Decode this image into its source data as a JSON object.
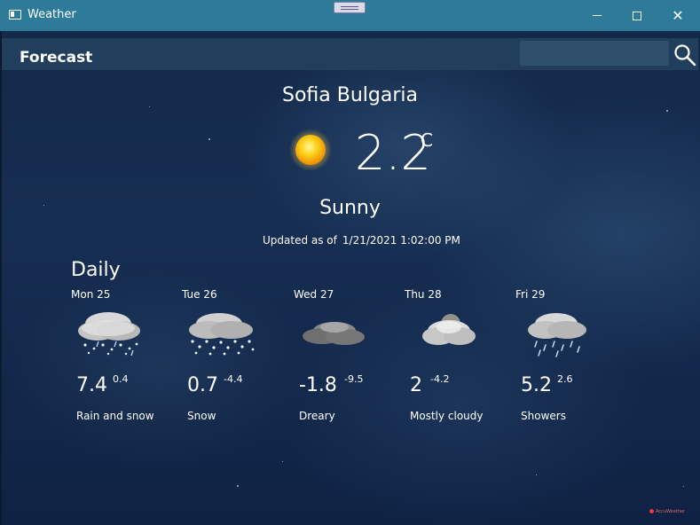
{
  "window": {
    "title": "Weather",
    "buttons": {
      "minimize": "minimize",
      "maximize": "maximize",
      "close": "close"
    }
  },
  "header": {
    "tab_label": "Forecast",
    "search": {
      "value": "",
      "placeholder": ""
    }
  },
  "current": {
    "city": "Sofia",
    "country": "Bulgaria",
    "temperature": "2.2",
    "unit": "C",
    "condition": "Sunny",
    "icon": "sun-icon",
    "updated_prefix": "Updated as of",
    "updated_time": "1/21/2021 1:02:00 PM"
  },
  "daily": {
    "title": "Daily",
    "days": [
      {
        "name": "Mon 25",
        "high": "7.4",
        "low": "0.4",
        "description": "Rain and snow",
        "icon": "rain-snow-icon"
      },
      {
        "name": "Tue 26",
        "high": "0.7",
        "low": "-4.4",
        "description": "Snow",
        "icon": "snow-icon"
      },
      {
        "name": "Wed 27",
        "high": "-1.8",
        "low": "-9.5",
        "description": "Dreary",
        "icon": "dreary-cloud-icon"
      },
      {
        "name": "Thu 28",
        "high": "2",
        "low": "-4.2",
        "description": "Mostly cloudy",
        "icon": "mostly-cloudy-icon"
      },
      {
        "name": "Fri 29",
        "high": "5.2",
        "low": "2.6",
        "description": "Showers",
        "icon": "showers-icon"
      }
    ]
  },
  "footer": {
    "brand": "AccuWeather"
  },
  "colors": {
    "titlebar": "#2e7a99",
    "topbar": "#213f5c",
    "background": "#162e52",
    "text": "#ffffff",
    "sun": "#f7b500"
  }
}
